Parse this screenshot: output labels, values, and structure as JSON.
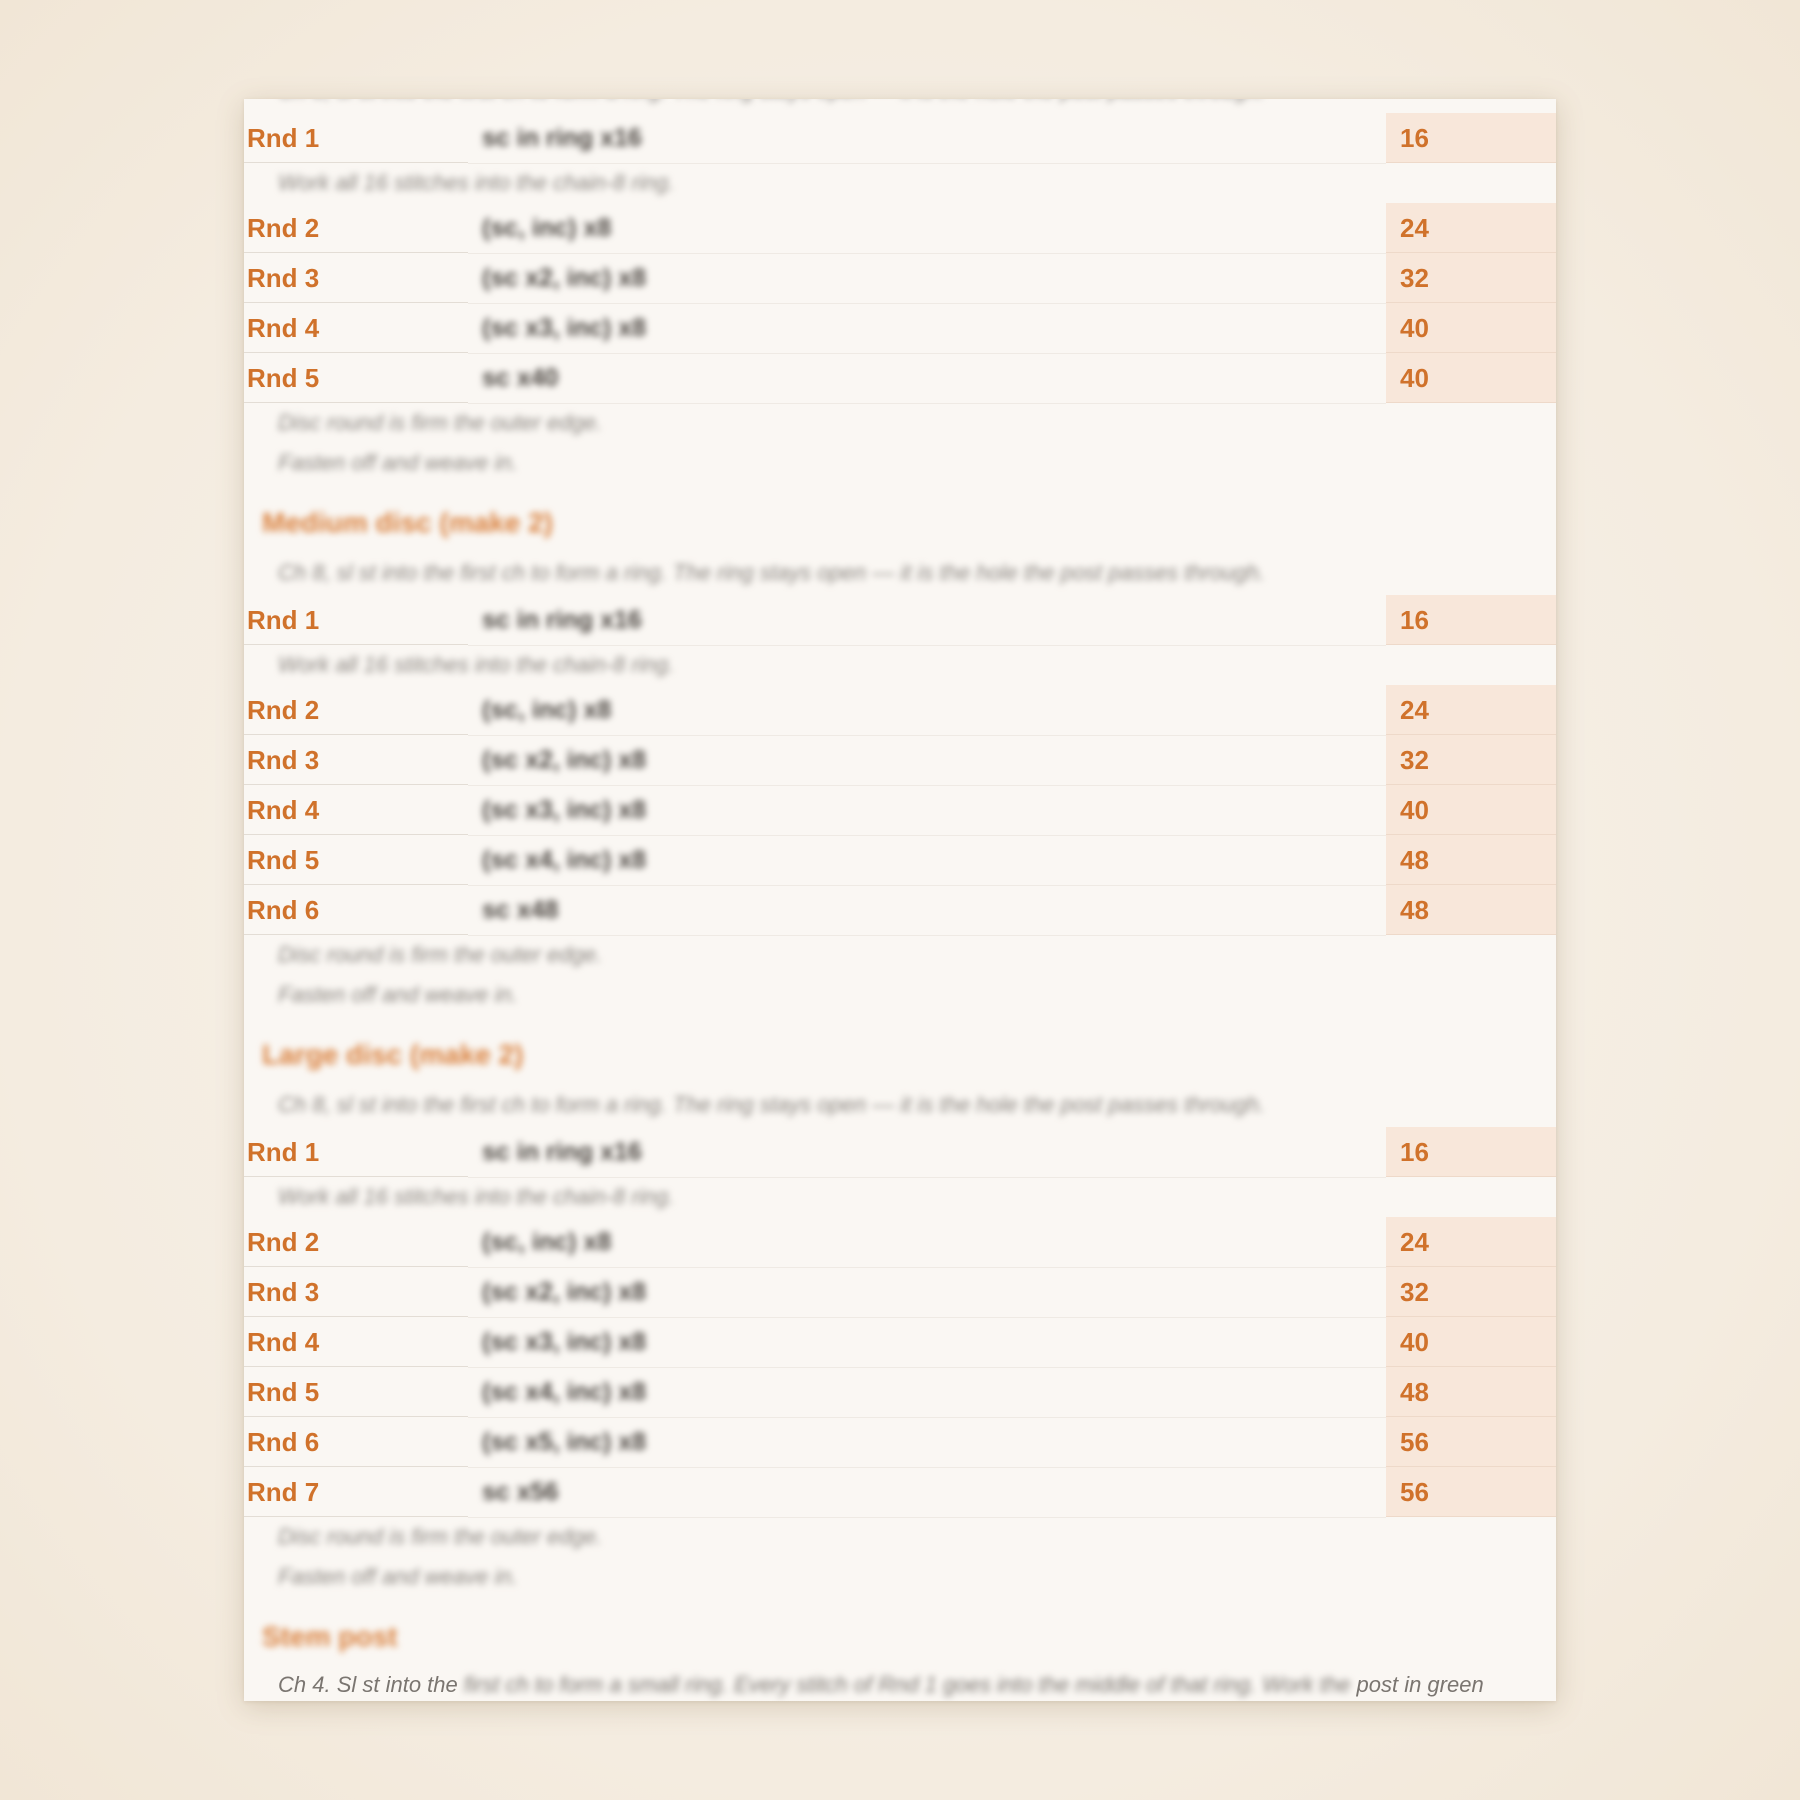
{
  "intro_note": "Ch 8, sl st into the first ch to form a ring. The ring stays open — it is the hole the post passes through.",
  "ring_note": "Work all 16 stitches into the chain-8 ring.",
  "finish_note_1": "Disc round is firm the outer edge.",
  "finish_note_2": "Fasten off and weave in.",
  "sections": [
    {
      "title": "",
      "rows": [
        {
          "label": "Rnd 1",
          "instr": "sc in ring x16",
          "count": "16",
          "note": "Work all 16 stitches into the chain-8 ring."
        },
        {
          "label": "Rnd 2",
          "instr": "(sc, inc) x8",
          "count": "24"
        },
        {
          "label": "Rnd 3",
          "instr": "(sc x2, inc) x8",
          "count": "32"
        },
        {
          "label": "Rnd 4",
          "instr": "(sc x3, inc) x8",
          "count": "40"
        },
        {
          "label": "Rnd 5",
          "instr": "sc x40",
          "count": "40"
        }
      ]
    },
    {
      "title": "Medium disc (make 2)",
      "rows": [
        {
          "label": "Rnd 1",
          "instr": "sc in ring x16",
          "count": "16",
          "note": "Work all 16 stitches into the chain-8 ring."
        },
        {
          "label": "Rnd 2",
          "instr": "(sc, inc) x8",
          "count": "24"
        },
        {
          "label": "Rnd 3",
          "instr": "(sc x2, inc) x8",
          "count": "32"
        },
        {
          "label": "Rnd 4",
          "instr": "(sc x3, inc) x8",
          "count": "40"
        },
        {
          "label": "Rnd 5",
          "instr": "(sc x4, inc) x8",
          "count": "48"
        },
        {
          "label": "Rnd 6",
          "instr": "sc x48",
          "count": "48"
        }
      ]
    },
    {
      "title": "Large disc (make 2)",
      "rows": [
        {
          "label": "Rnd 1",
          "instr": "sc in ring x16",
          "count": "16",
          "note": "Work all 16 stitches into the chain-8 ring."
        },
        {
          "label": "Rnd 2",
          "instr": "(sc, inc) x8",
          "count": "24"
        },
        {
          "label": "Rnd 3",
          "instr": "(sc x2, inc) x8",
          "count": "32"
        },
        {
          "label": "Rnd 4",
          "instr": "(sc x3, inc) x8",
          "count": "40"
        },
        {
          "label": "Rnd 5",
          "instr": "(sc x4, inc) x8",
          "count": "48"
        },
        {
          "label": "Rnd 6",
          "instr": "(sc x5, inc) x8",
          "count": "56"
        },
        {
          "label": "Rnd 7",
          "instr": "sc x56",
          "count": "56"
        }
      ]
    }
  ],
  "stem": {
    "title": "Stem post",
    "note_start": "Ch 4. Sl st into the",
    "note_middle": "first ch to form a small ring. Every stitch of Rnd 1 goes into the middle of that ring. Work the",
    "note_end": "post in green"
  },
  "colors": {
    "accent": "#d0722b",
    "count_fill": "#f8e7da",
    "paper": "#faf7f3"
  }
}
